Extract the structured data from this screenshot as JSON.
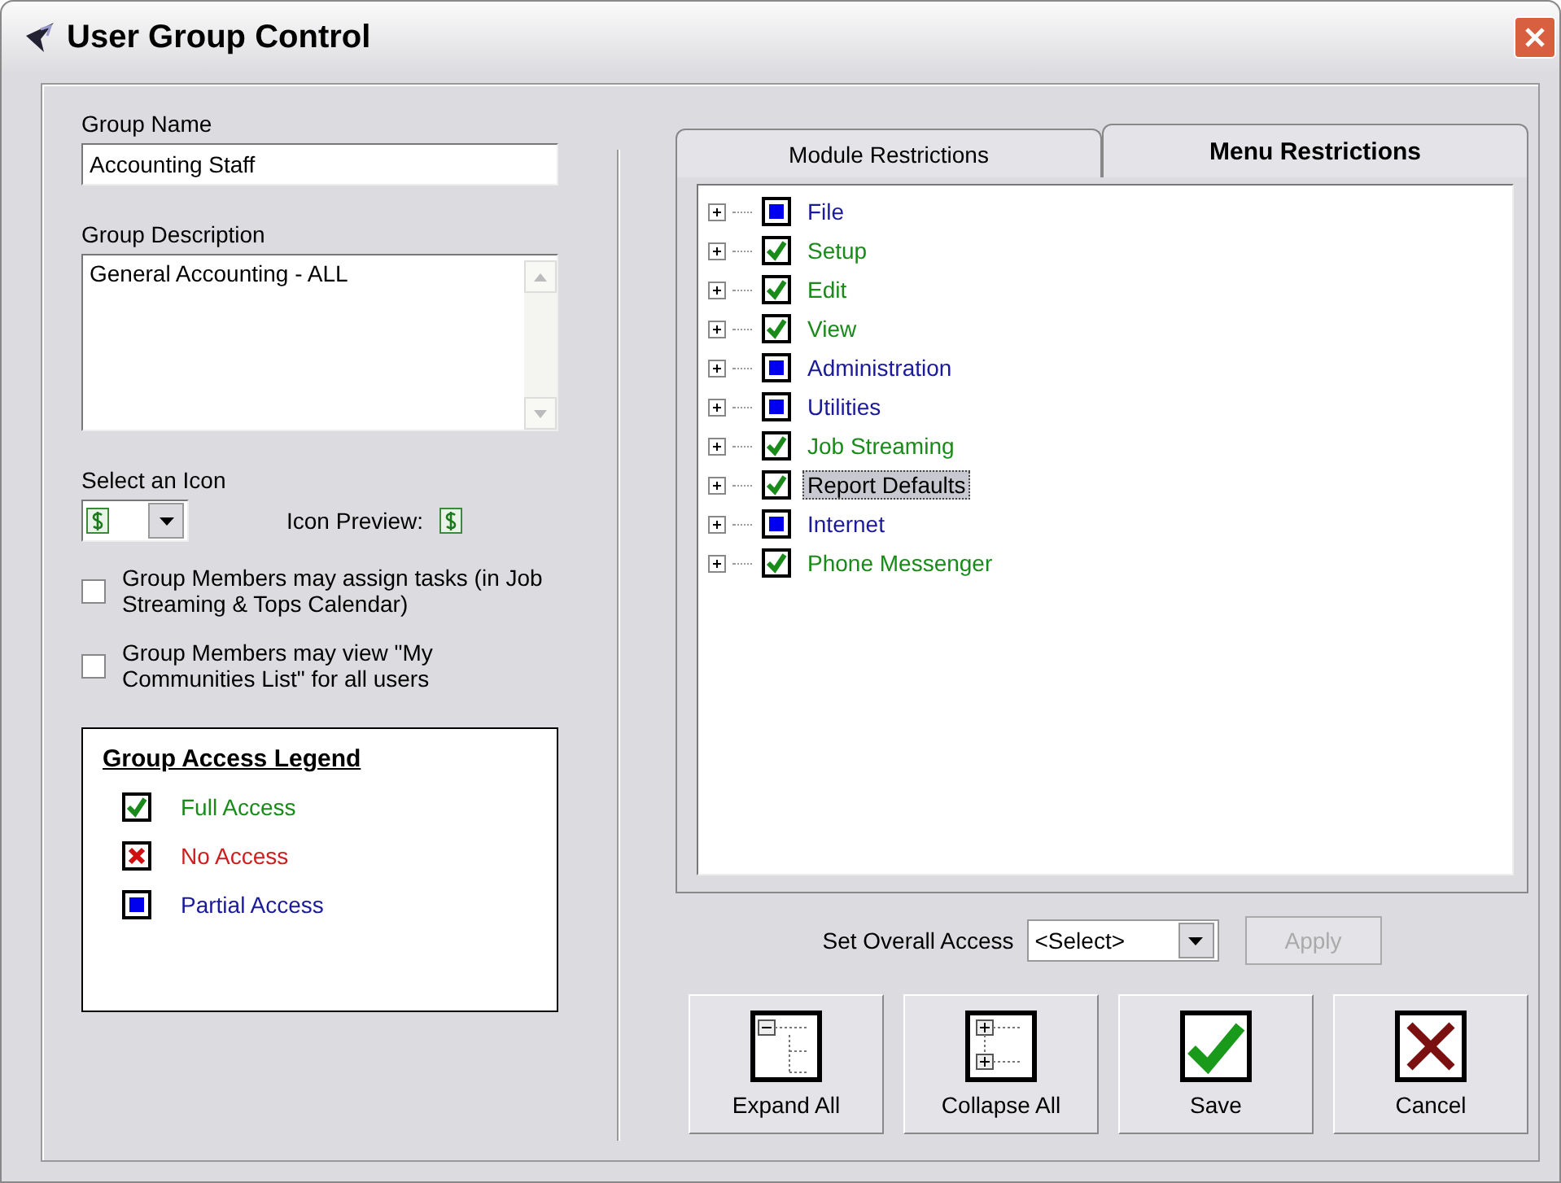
{
  "window": {
    "title": "User Group Control"
  },
  "group_name": {
    "label": "Group Name",
    "value": "Accounting Staff"
  },
  "group_description": {
    "label": "Group Description",
    "value": "General Accounting - ALL"
  },
  "icon_select": {
    "label": "Select an Icon",
    "preview_label": "Icon Preview:"
  },
  "options": [
    {
      "label": "Group Members may assign tasks (in Job Streaming & Tops Calendar)",
      "checked": false
    },
    {
      "label": "Group Members may view \"My Communities List\" for all users",
      "checked": false
    }
  ],
  "legend": {
    "title": "Group Access Legend",
    "items": [
      {
        "kind": "full",
        "label": "Full Access"
      },
      {
        "kind": "none",
        "label": "No Access"
      },
      {
        "kind": "partial",
        "label": "Partial Access"
      }
    ]
  },
  "tabs": [
    {
      "label": "Module Restrictions",
      "selected": false
    },
    {
      "label": "Menu Restrictions",
      "selected": true
    }
  ],
  "tree": [
    {
      "label": "File",
      "kind": "partial",
      "selected": false,
      "expanded": false
    },
    {
      "label": "Setup",
      "kind": "full",
      "selected": false,
      "expanded": false
    },
    {
      "label": "Edit",
      "kind": "full",
      "selected": false,
      "expanded": false
    },
    {
      "label": "View",
      "kind": "full",
      "selected": false,
      "expanded": false
    },
    {
      "label": "Administration",
      "kind": "partial",
      "selected": false,
      "expanded": false
    },
    {
      "label": "Utilities",
      "kind": "partial",
      "selected": false,
      "expanded": false
    },
    {
      "label": "Job Streaming",
      "kind": "full",
      "selected": false,
      "expanded": false
    },
    {
      "label": "Report Defaults",
      "kind": "full",
      "selected": true,
      "expanded": false
    },
    {
      "label": "Internet",
      "kind": "partial",
      "selected": false,
      "expanded": false
    },
    {
      "label": "Phone Messenger",
      "kind": "full",
      "selected": false,
      "expanded": false
    }
  ],
  "overall_access": {
    "label": "Set Overall Access",
    "value": "<Select>",
    "apply": {
      "label": "Apply",
      "disabled": true
    }
  },
  "buttons": [
    {
      "kind": "expand",
      "label": "Expand All"
    },
    {
      "kind": "collapse",
      "label": "Collapse All"
    },
    {
      "kind": "save",
      "label": "Save"
    },
    {
      "kind": "cancel",
      "label": "Cancel"
    }
  ]
}
